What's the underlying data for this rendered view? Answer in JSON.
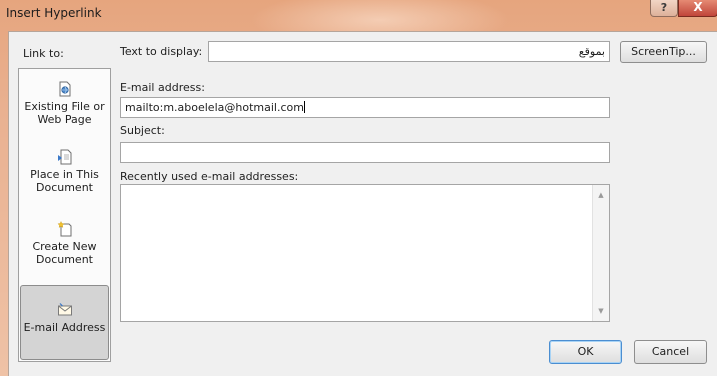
{
  "window": {
    "title": "Insert Hyperlink",
    "help_label": "?",
    "close_label": "X"
  },
  "link_to": {
    "label": "Link to:",
    "items": [
      {
        "line1": "Existing File or",
        "line2": "Web Page",
        "icon": "existing-file-icon",
        "selected": false
      },
      {
        "line1": "Place in This",
        "line2": "Document",
        "icon": "place-in-document-icon",
        "selected": false
      },
      {
        "line1": "Create New",
        "line2": "Document",
        "icon": "new-document-icon",
        "selected": false
      },
      {
        "line1": "E-mail Address",
        "line2": "",
        "icon": "email-address-icon",
        "selected": true
      }
    ]
  },
  "text_to_display": {
    "label": "Text to display:",
    "value": "بموقع"
  },
  "screentip_button": "ScreenTip...",
  "email": {
    "label": "E-mail address:",
    "value": "mailto:m.aboelela@hotmail.com"
  },
  "subject": {
    "label": "Subject:",
    "value": ""
  },
  "recent": {
    "label": "Recently used e-mail addresses:",
    "items": []
  },
  "buttons": {
    "ok": "OK",
    "cancel": "Cancel"
  },
  "colors": {
    "title_bar": "#e9b191",
    "dialog_bg": "#f0f0f0",
    "close_button": "#c0463a",
    "selected_item": "#d4d4d4"
  }
}
